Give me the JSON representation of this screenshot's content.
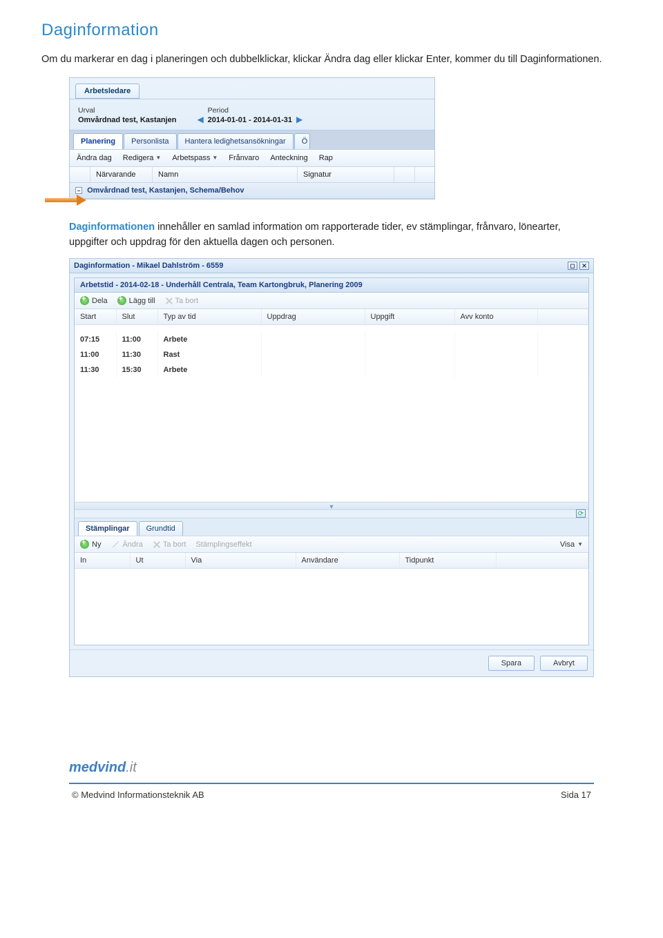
{
  "page": {
    "heading": "Daginformation",
    "intro": "Om du markerar en dag i planeringen och dubbelklickar, klickar Ändra dag eller klickar Enter, kommer du till Daginformationen.",
    "intro2_strong": "Daginformationen",
    "intro2_rest": " innehåller en samlad information om rapporterade tider, ev stämplingar, frånvaro, lönearter, uppgifter och uppdrag för den aktuella dagen och personen."
  },
  "shot1": {
    "top_tab": "Arbetsledare",
    "urval_label": "Urval",
    "urval_value": "Omvårdnad test, Kastanjen",
    "period_label": "Period",
    "period_value": "2014-01-01 - 2014-01-31",
    "main_tabs": [
      "Planering",
      "Personlista",
      "Hantera ledighetsansökningar",
      "Ö"
    ],
    "toolbar": [
      "Ändra dag",
      "Redigera",
      "Arbetspass",
      "Frånvaro",
      "Anteckning",
      "Rap"
    ],
    "col_headers": [
      "",
      "Närvarande",
      "Namn",
      "Signatur",
      ""
    ],
    "group_row": "Omvårdnad test, Kastanjen, Schema/Behov"
  },
  "shot2": {
    "title": "Daginformation - Mikael Dahlström - 6559",
    "panel_title": "Arbetstid - 2014-02-18 - Underhåll Centrala, Team Kartongbruk, Planering 2009",
    "toolbar": {
      "dela": "Dela",
      "lagg_till": "Lägg till",
      "ta_bort": "Ta bort"
    },
    "columns": [
      "Start",
      "Slut",
      "Typ av tid",
      "Uppdrag",
      "Uppgift",
      "Avv konto"
    ],
    "rows": [
      {
        "start": "07:15",
        "slut": "11:00",
        "typ": "Arbete",
        "uppdrag": "",
        "uppgift": "",
        "avv": ""
      },
      {
        "start": "11:00",
        "slut": "11:30",
        "typ": "Rast",
        "uppdrag": "",
        "uppgift": "",
        "avv": ""
      },
      {
        "start": "11:30",
        "slut": "15:30",
        "typ": "Arbete",
        "uppdrag": "",
        "uppgift": "",
        "avv": ""
      }
    ],
    "bottom_tabs": [
      "Stämplingar",
      "Grundtid"
    ],
    "bottom_toolbar": {
      "ny": "Ny",
      "andra": "Ändra",
      "ta_bort": "Ta bort",
      "effekt": "Stämplingseffekt",
      "visa": "Visa"
    },
    "bottom_columns": [
      "In",
      "Ut",
      "Via",
      "Användare",
      "Tidpunkt"
    ],
    "footer": {
      "spara": "Spara",
      "avbryt": "Avbryt"
    }
  },
  "footer": {
    "logo1": "medvind",
    "logo2": ".it",
    "copyright": "©  Medvind Informationsteknik AB",
    "page": "Sida 17"
  }
}
